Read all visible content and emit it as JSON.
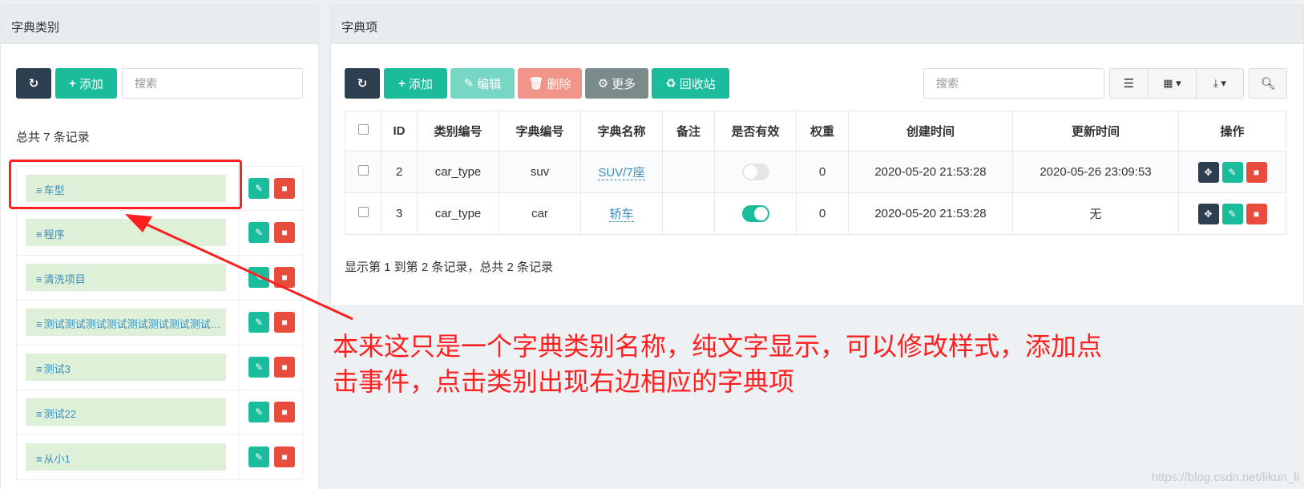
{
  "left": {
    "title": "字典类别",
    "add_label": "添加",
    "search_placeholder": "搜索",
    "record_count": "总共 7 条记录",
    "categories": [
      {
        "label": "车型"
      },
      {
        "label": "程序"
      },
      {
        "label": "清洗项目"
      },
      {
        "label": "测试测试测试测试测试测试测试测试测试测试"
      },
      {
        "label": "测试3"
      },
      {
        "label": "测试22"
      },
      {
        "label": "从小1"
      }
    ]
  },
  "right": {
    "title": "字典项",
    "toolbar": {
      "add_label": "添加",
      "edit_label": "编辑",
      "delete_label": "删除",
      "more_label": "更多",
      "recycle_label": "回收站"
    },
    "search_placeholder": "搜索",
    "columns": [
      "ID",
      "类别编号",
      "字典编号",
      "字典名称",
      "备注",
      "是否有效",
      "权重",
      "创建时间",
      "更新时间",
      "操作"
    ],
    "rows": [
      {
        "id": "2",
        "type_code": "car_type",
        "dict_code": "suv",
        "dict_name": "SUV/7座",
        "remark": "",
        "enabled": false,
        "weight": "0",
        "created": "2020-05-20 21:53:28",
        "updated": "2020-05-26 23:09:53"
      },
      {
        "id": "3",
        "type_code": "car_type",
        "dict_code": "car",
        "dict_name": "轿车",
        "remark": "",
        "enabled": true,
        "weight": "0",
        "created": "2020-05-20 21:53:28",
        "updated": "无"
      }
    ],
    "pagination": "显示第 1 到第 2 条记录，总共 2 条记录"
  },
  "annotation": {
    "line1": "本来这只是一个字典类别名称，纯文字显示，可以修改样式，添加点",
    "line2": "击事件，点击类别出现右边相应的字典项"
  },
  "watermark": "https://blog.csdn.net/likun_li",
  "colors": {
    "primary_dark": "#2c3e50",
    "success": "#1abc9c",
    "danger": "#e74c3c",
    "annotation_red": "#ff1f1f"
  }
}
